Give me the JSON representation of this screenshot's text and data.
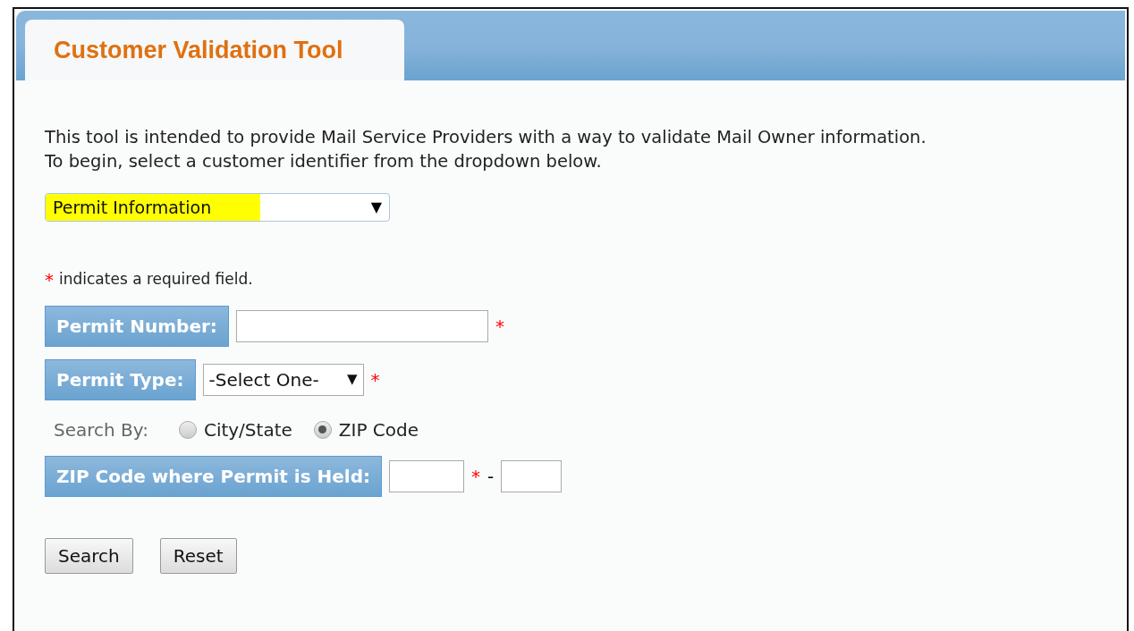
{
  "tab": {
    "title": "Customer Validation Tool",
    "selected": true
  },
  "intro": [
    "This tool is intended to provide Mail Service Providers with a way to validate Mail Owner information.",
    "To begin, select a customer identifier from the dropdown below."
  ],
  "identifier_dropdown": {
    "value": "Permit Information",
    "arrow": "▼",
    "highlighted": true
  },
  "required_note": {
    "mark": "*",
    "text": "indicates a required field."
  },
  "fields": [
    {
      "kind": "text",
      "label": "Permit Number:",
      "required_mark": "*"
    },
    {
      "kind": "select",
      "label": "Permit Type:",
      "value": "-Select One-",
      "arrow": "▼",
      "required_mark": "*"
    }
  ],
  "search_by": {
    "label": "Search By:",
    "options": [
      {
        "label": "City/State",
        "selected": false
      },
      {
        "label": "ZIP Code",
        "selected": true
      }
    ]
  },
  "zip_field": {
    "label": "ZIP Code where Permit is Held:",
    "required_mark": "*",
    "separator": "-"
  },
  "buttons": [
    "Search",
    "Reset"
  ]
}
